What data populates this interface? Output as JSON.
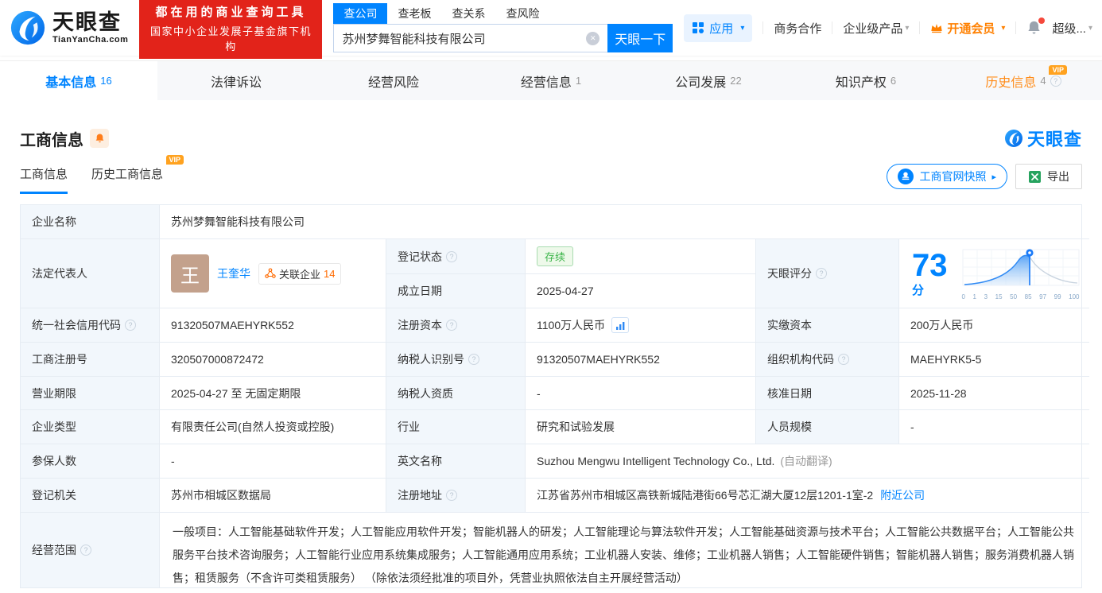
{
  "brand": {
    "name": "天眼查",
    "domain": "TianYanCha.com",
    "watermark": "天眼查"
  },
  "banner": {
    "line1": "都在用的商业查询工具",
    "line2": "国家中小企业发展子基金旗下机构"
  },
  "search": {
    "tabs": [
      "查公司",
      "查老板",
      "查关系",
      "查风险"
    ],
    "value": "苏州梦舞智能科技有限公司",
    "button": "天眼一下"
  },
  "nav": {
    "apps": "应用",
    "biz": "商务合作",
    "enterprise": "企业级产品",
    "vip": "开通会员",
    "user": "超级..."
  },
  "tabs": [
    {
      "label": "基本信息",
      "count": "16"
    },
    {
      "label": "法律诉讼",
      "count": ""
    },
    {
      "label": "经营风险",
      "count": ""
    },
    {
      "label": "经营信息",
      "count": "1"
    },
    {
      "label": "公司发展",
      "count": "22"
    },
    {
      "label": "知识产权",
      "count": "6"
    },
    {
      "label": "历史信息",
      "count": "4"
    }
  ],
  "vip_text": "VIP",
  "section": {
    "title": "工商信息",
    "subtab_current": "工商信息",
    "subtab_history": "历史工商信息",
    "snapshot": "工商官网快照",
    "export": "导出"
  },
  "score": {
    "value": "73",
    "unit": "分",
    "axis": [
      "0",
      "1",
      "3",
      "15",
      "50",
      "85",
      "97",
      "99",
      "100"
    ]
  },
  "fields": {
    "company_name": {
      "label": "企业名称",
      "value": "苏州梦舞智能科技有限公司"
    },
    "legal_rep": {
      "label": "法定代表人",
      "avatar": "王",
      "name": "王奎华",
      "related_label": "关联企业",
      "related_count": "14"
    },
    "reg_status": {
      "label": "登记状态",
      "value": "存续"
    },
    "establish_date": {
      "label": "成立日期",
      "value": "2025-04-27"
    },
    "tianyan_score": {
      "label": "天眼评分"
    },
    "credit_code": {
      "label": "统一社会信用代码",
      "value": "91320507MAEHYRK552"
    },
    "reg_capital": {
      "label": "注册资本",
      "value": "1100万人民币"
    },
    "paid_capital": {
      "label": "实缴资本",
      "value": "200万人民币"
    },
    "reg_number": {
      "label": "工商注册号",
      "value": "320507000872472"
    },
    "taxpayer_id": {
      "label": "纳税人识别号",
      "value": "91320507MAEHYRK552"
    },
    "org_code": {
      "label": "组织机构代码",
      "value": "MAEHYRK5-5"
    },
    "business_term": {
      "label": "营业期限",
      "value": "2025-04-27 至 无固定期限"
    },
    "taxpayer_quali": {
      "label": "纳税人资质",
      "value": "-"
    },
    "approve_date": {
      "label": "核准日期",
      "value": "2025-11-28"
    },
    "company_type": {
      "label": "企业类型",
      "value": "有限责任公司(自然人投资或控股)"
    },
    "industry": {
      "label": "行业",
      "value": "研究和试验发展"
    },
    "staff_size": {
      "label": "人员规模",
      "value": "-"
    },
    "insured_count": {
      "label": "参保人数",
      "value": "-"
    },
    "english_name": {
      "label": "英文名称",
      "value": "Suzhou Mengwu Intelligent Technology Co., Ltd.",
      "note": "(自动翻译)"
    },
    "reg_authority": {
      "label": "登记机关",
      "value": "苏州市相城区数据局"
    },
    "reg_address": {
      "label": "注册地址",
      "value": "江苏省苏州市相城区高铁新城陆港街66号芯汇湖大厦12层1201-1室-2",
      "link": "附近公司"
    },
    "business_scope": {
      "label": "经营范围",
      "value": "一般项目：人工智能基础软件开发；人工智能应用软件开发；智能机器人的研发；人工智能理论与算法软件开发；人工智能基础资源与技术平台；人工智能公共数据平台；人工智能公共服务平台技术咨询服务；人工智能行业应用系统集成服务；人工智能通用应用系统；工业机器人安装、维修；工业机器人销售；人工智能硬件销售；智能机器人销售；服务消费机器人销售；租赁服务（不含许可类租赁服务） （除依法须经批准的项目外，凭营业执照依法自主开展经营活动）"
    }
  },
  "icons": {
    "caret": "▾",
    "arrow_right": "▸",
    "help": "?",
    "close": "✕"
  },
  "colors": {
    "brand_blue": "#0084ff",
    "banner_red": "#e2231a",
    "vip_orange": "#ff8000",
    "status_green": "#3cb54a"
  }
}
